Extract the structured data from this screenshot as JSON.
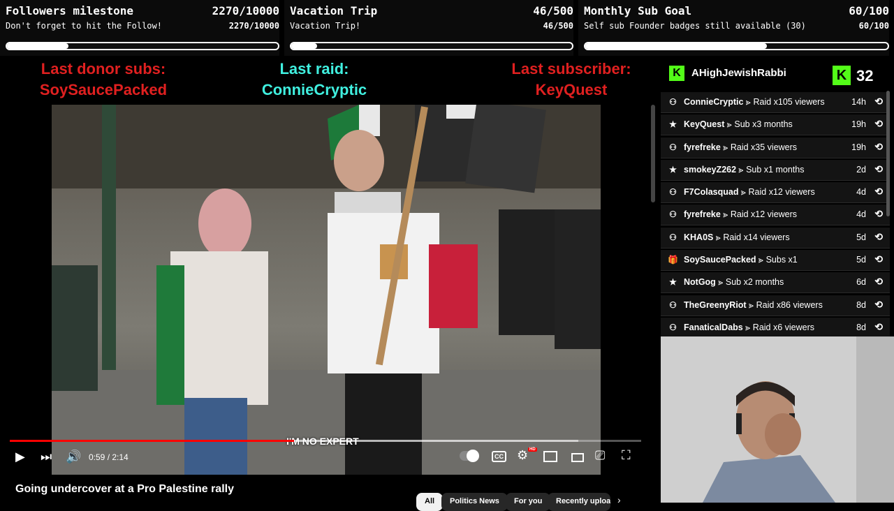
{
  "goals": [
    {
      "title": "Followers milestone",
      "count": "2270/10000",
      "subtitle": "Don't forget to hit the Follow!",
      "sub_count": "2270/10000",
      "progress": 0.227
    },
    {
      "title": "Vacation Trip",
      "count": "46/500",
      "subtitle": "Vacation Trip!",
      "sub_count": "46/500",
      "progress": 0.092
    },
    {
      "title": "Monthly Sub Goal",
      "count": "60/100",
      "subtitle": "Self sub Founder badges still available (30)",
      "sub_count": "60/100",
      "progress": 0.6
    }
  ],
  "banners": {
    "donor_label": "Last donor subs:",
    "donor_value": "SoySaucePacked",
    "raid_label": "Last raid:",
    "raid_value": "ConnieCryptic",
    "sub_label": "Last subscriber:",
    "sub_value": "KeyQuest"
  },
  "feed": {
    "streamer": "AHighJewishRabbi",
    "viewer_count": "32",
    "events": [
      {
        "icon": "raid-icon",
        "user": "ConnieCryptic",
        "action": "Raid x105 viewers",
        "time": "14h"
      },
      {
        "icon": "star-icon",
        "user": "KeyQuest",
        "action": "Sub x3 months",
        "time": "19h"
      },
      {
        "icon": "raid-icon",
        "user": "fyrefreke",
        "action": "Raid x35 viewers",
        "time": "19h"
      },
      {
        "icon": "star-icon",
        "user": "smokeyZ262",
        "action": "Sub x1 months",
        "time": "2d"
      },
      {
        "icon": "raid-icon",
        "user": "F7Colasquad",
        "action": "Raid x12 viewers",
        "time": "4d"
      },
      {
        "icon": "raid-icon",
        "user": "fyrefreke",
        "action": "Raid x12 viewers",
        "time": "4d"
      },
      {
        "icon": "raid-icon",
        "user": "KHA0S",
        "action": "Raid x14 viewers",
        "time": "5d"
      },
      {
        "icon": "gift-icon",
        "user": "SoySaucePacked",
        "action": "Subs x1",
        "time": "5d"
      },
      {
        "icon": "star-icon",
        "user": "NotGog",
        "action": "Sub x2 months",
        "time": "6d"
      },
      {
        "icon": "raid-icon",
        "user": "TheGreenyRiot",
        "action": "Raid x86 viewers",
        "time": "8d"
      },
      {
        "icon": "raid-icon",
        "user": "FanaticalDabs",
        "action": "Raid x6 viewers",
        "time": "8d"
      }
    ]
  },
  "player": {
    "caption": "I'M NO EXPERT",
    "time": "0:59 / 2:14",
    "played": 0.45,
    "buffered": 0.9,
    "video_title": "Going undercover at a Pro Palestine rally",
    "chips": [
      "All",
      "Politics News",
      "For you",
      "Recently uploaded"
    ]
  }
}
